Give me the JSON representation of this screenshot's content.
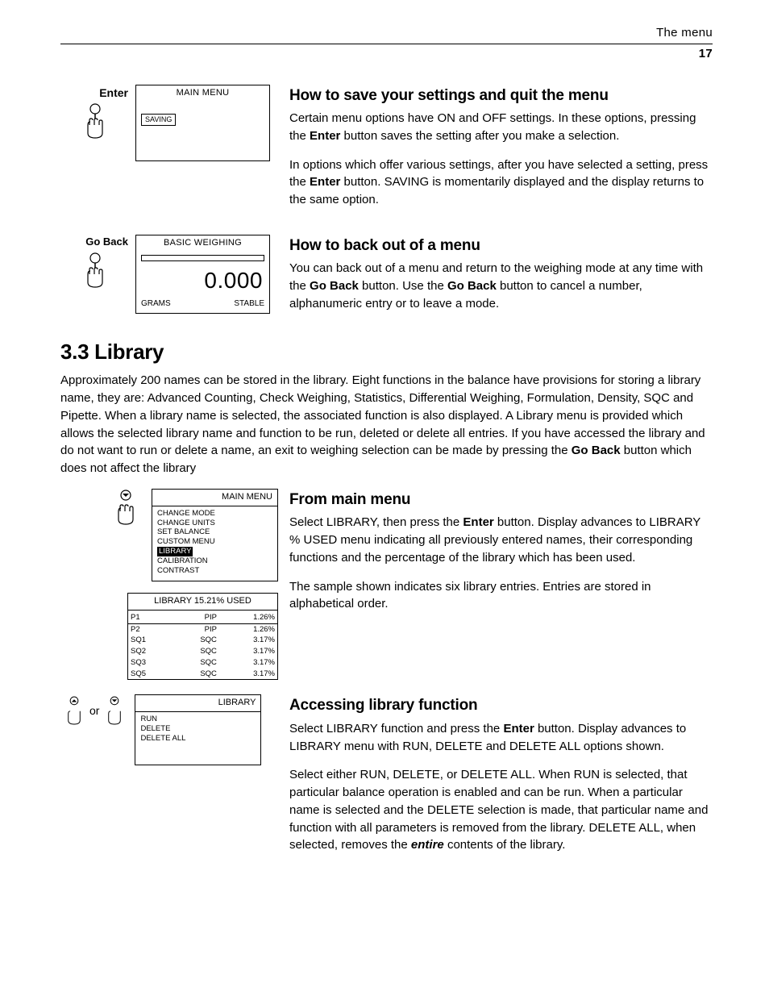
{
  "header": {
    "title": "The menu",
    "page": "17"
  },
  "row1": {
    "hand_label": "Enter",
    "lcd_title": "MAIN MENU",
    "lcd_tag": "SAVING",
    "heading": "How to save your settings and quit the menu",
    "p1a": "Certain menu options have ON and OFF settings. In these options, pressing the ",
    "enter_bold": "Enter",
    "p1b": " button saves the setting after you make a selection.",
    "p2a": "In options which offer various settings, after you have selected a setting, press the ",
    "p2b": " button. SAVING is momentarily displayed and the display returns to the same option."
  },
  "row2": {
    "hand_label": "Go Back",
    "lcd_title": "BASIC WEIGHING",
    "lcd_reading": "0.000",
    "lcd_foot_left": "GRAMS",
    "lcd_foot_right": "STABLE",
    "heading": "How to back out of a menu",
    "p1a": "You can back out of a menu and return to the weighing mode at any time with the ",
    "goback_bold": "Go Back",
    "p1b": " button. Use the ",
    "p1c": " button to cancel a number, alphanumeric entry or to leave a mode."
  },
  "section": {
    "heading": "3.3   Library",
    "body_a": "Approximately 200 names can be stored in the library. Eight functions in the balance have provisions for storing a library name, they are: Advanced Counting, Check Weighing, Statistics, Differential Weighing, Formulation, Density, SQC and Pipette. When a library name is selected, the associated function is also displayed. A Library menu is provided which allows the selected library name and function to be run, deleted or delete all entries. If you have accessed the library and do not want to run or delete a name, an exit to weighing selection can be made by pressing the ",
    "goback_bold": "Go Back",
    "body_b": " button which does not affect the library"
  },
  "row3": {
    "lcd1_title": "MAIN  MENU",
    "lcd1_items": [
      "CHANGE MODE",
      "CHANGE UNITS",
      "SET BALANCE",
      "CUSTOM MENU",
      "LIBRARY",
      "CALIBRATION",
      "CONTRAST"
    ],
    "lcd1_highlight": "LIBRARY",
    "lcd2_title": "LIBRARY 15.21% USED",
    "lcd2_rows": [
      {
        "name": "P1",
        "fn": "PIP",
        "pct": "1.26%"
      },
      {
        "name": "P2",
        "fn": "PIP",
        "pct": "1.26%"
      },
      {
        "name": "SQ1",
        "fn": "SQC",
        "pct": "3.17%"
      },
      {
        "name": "SQ2",
        "fn": "SQC",
        "pct": "3.17%"
      },
      {
        "name": "SQ3",
        "fn": "SQC",
        "pct": "3.17%"
      },
      {
        "name": "SQ5",
        "fn": "SQC",
        "pct": "3.17%"
      }
    ],
    "heading": "From main menu",
    "p1a": "Select LIBRARY, then press the ",
    "enter_bold": "Enter",
    "p1b": " button. Display advances to LIBRARY % USED menu indicating all previously entered names, their corresponding functions and the percentage of the library which has been used.",
    "p2": "The sample shown indicates six library entries. Entries are stored in alphabetical order."
  },
  "row4": {
    "or_word": "or",
    "lcd_title": "LIBRARY",
    "lcd_items": [
      "RUN",
      "DELETE",
      "DELETE ALL"
    ],
    "lcd_highlight": "RUN",
    "heading": "Accessing library function",
    "p1a": "Select LIBRARY function and press the ",
    "enter_bold": "Enter",
    "p1b": " button. Display advances to LIBRARY menu with RUN, DELETE and DELETE ALL options shown.",
    "p2a": "Select either RUN, DELETE, or DELETE ALL. When RUN is selected, that particular balance operation is enabled and can be run. When a particular name is selected and the DELETE selection is made, that particular name and function with all parameters is removed from the library. DELETE ALL, when selected, removes the ",
    "entire_word": "entire",
    "p2b": " contents of the library."
  }
}
